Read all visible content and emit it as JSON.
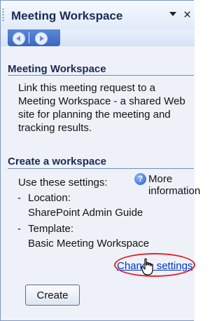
{
  "pane": {
    "title": "Meeting Workspace",
    "close_label": "×"
  },
  "section1": {
    "header": "Meeting Workspace",
    "description_lines": [
      "Link this meeting request to a",
      "Meeting Workspace - a shared Web",
      "site for planning the meeting and",
      "tracking results."
    ],
    "more_info_link": "More information",
    "more_info_icon": "help-icon"
  },
  "section2": {
    "header": "Create a workspace",
    "intro": "Use these settings:",
    "items": [
      {
        "bullet": "-",
        "label": "Location:",
        "value": "SharePoint Admin Guide"
      },
      {
        "bullet": "-",
        "label": "Template:",
        "value": "Basic Meeting Workspace"
      }
    ],
    "change_settings_link": "Change settings",
    "create_button": "Create"
  },
  "colors": {
    "accent": "#3a68c2",
    "header_text": "#1a2a55",
    "link": "#0033cc",
    "annotation": "#e2242a"
  }
}
